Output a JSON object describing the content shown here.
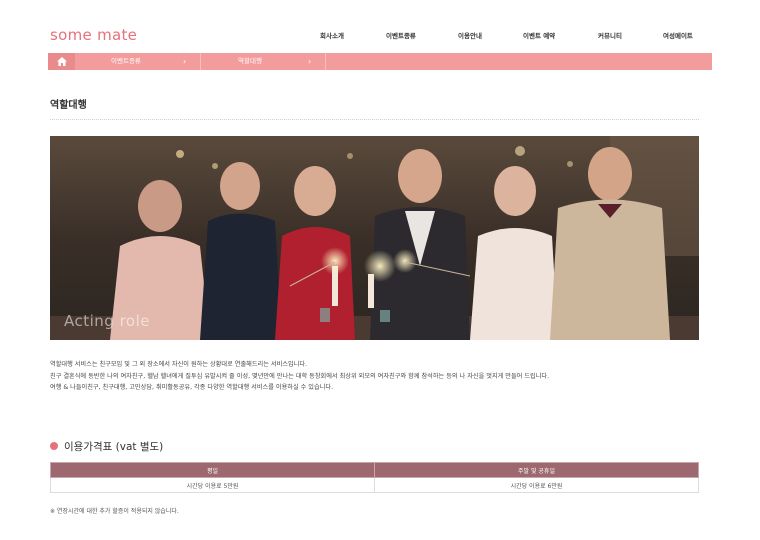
{
  "brand": {
    "logo_text": "some mate",
    "accent": "#e8707a"
  },
  "nav": {
    "items": [
      {
        "label": "회사소개"
      },
      {
        "label": "이벤트종류"
      },
      {
        "label": "이용안내"
      },
      {
        "label": "이벤트 예약"
      },
      {
        "label": "커뮤니티"
      },
      {
        "label": "여성메이트"
      }
    ]
  },
  "breadcrumb": {
    "home_icon": "home-icon",
    "items": [
      {
        "label": "이벤트종류"
      },
      {
        "label": "역할대행"
      }
    ],
    "bar_color": "#f39c9d"
  },
  "page": {
    "title": "역할대행"
  },
  "hero": {
    "caption": "Acting role"
  },
  "description": {
    "line1": "역할대행 서비스는 친구모임 및 그 외 장소에서 자신이 원하는 상황대로 연출해드리는 서비스입니다.",
    "line2": "친구 결혼식에 동반한 나의 여자친구, 헬남 헬녀에게 질투심 유발시켜 줄 이성, 몇년만에 만나는 대학 동창회에서 최상위 외모의 여자친구와 함께 참석하는 등의 나 자신을 멋지게 만들어 드립니다.",
    "line3": "여행 & 나들이친구, 친구대행, 고민상담, 취미활동공유, 각종 다양한 역할대행 서비스를 이용하실 수 있습니다."
  },
  "pricing": {
    "title": "이용가격표 (vat 별도)",
    "columns": [
      "평일",
      "주말 및 공휴일"
    ],
    "rows": [
      [
        "시간당 이용료 5만원",
        "시간당 이용료 6만원"
      ]
    ],
    "header_color": "#9e6870"
  },
  "note": "※ 연장시간에 대한 추가 할증이 적용되지 않습니다."
}
